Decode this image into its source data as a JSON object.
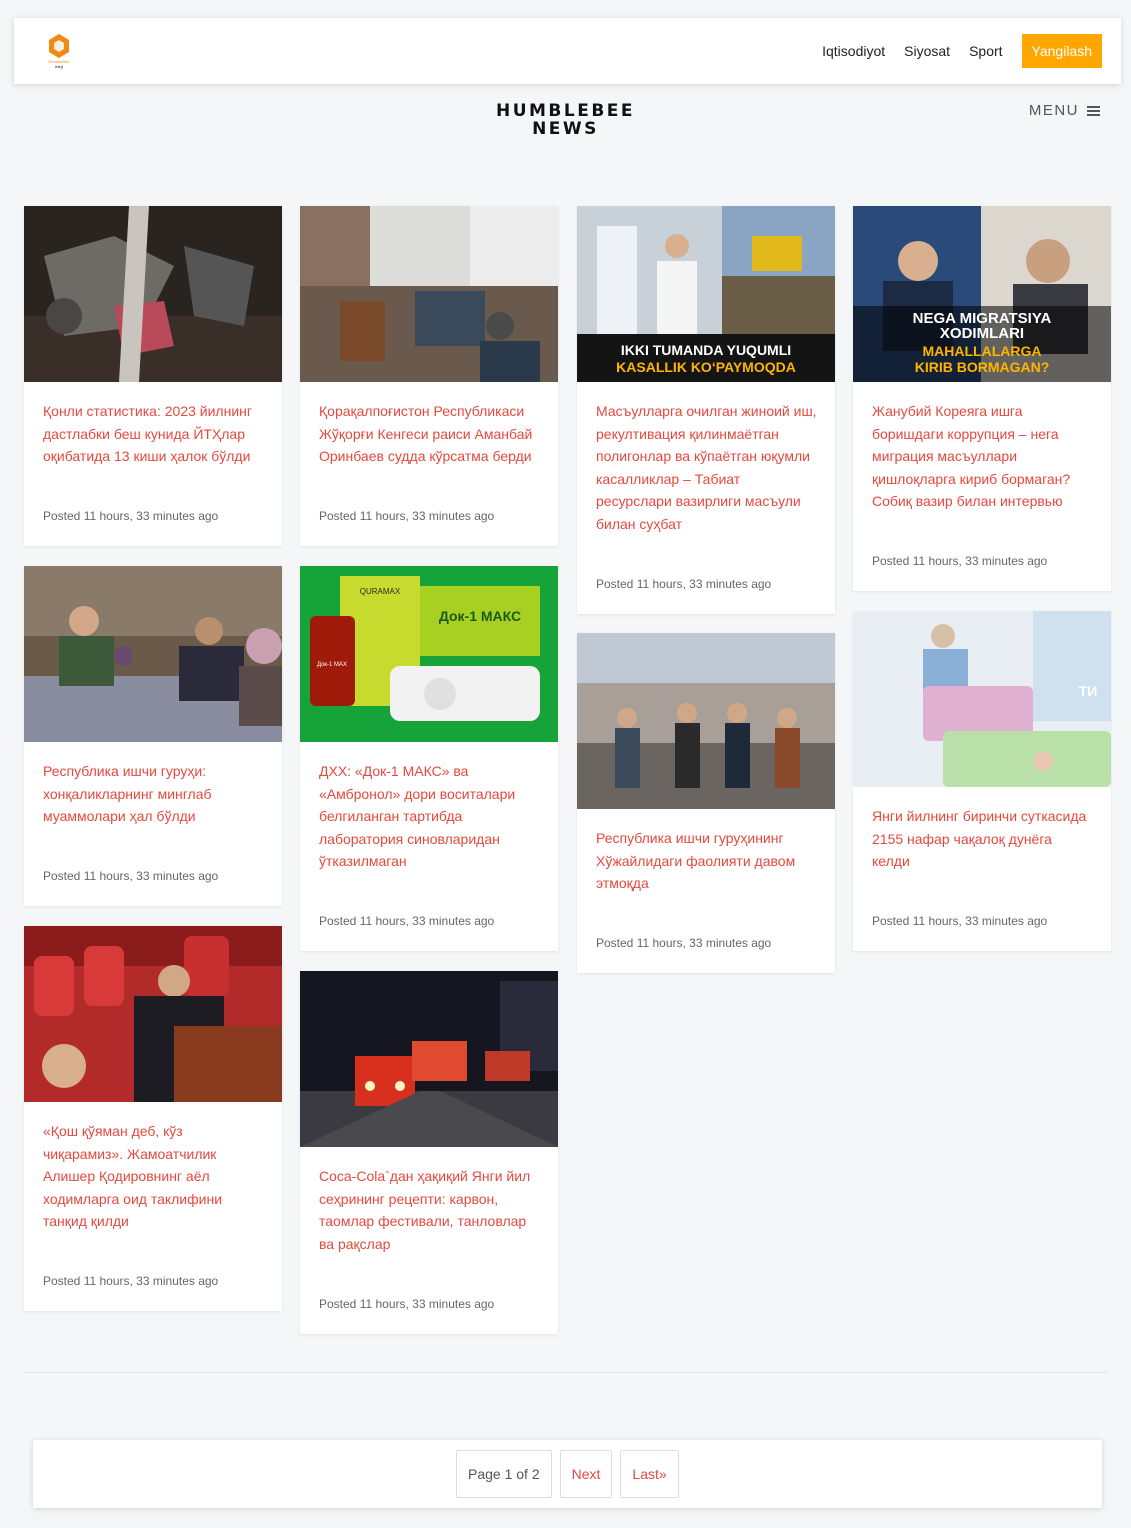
{
  "header": {
    "logo_text": "HumbleBee",
    "logo_sub": "telegi",
    "nav": [
      "Iqtisodiyot",
      "Siyosat",
      "Sport"
    ],
    "cta": "Yangilash"
  },
  "brand": {
    "line1": "HUMBLEBEE",
    "line2": "NEWS"
  },
  "menu_label": "MENU",
  "cards": [
    {
      "title": "Қонли статистика: 2023 йилнинг дастлабки беш кунида ЙТҲлар оқибатида 13 киши ҳалок бўлди",
      "posted": "Posted 11 hours, 33 minutes ago"
    },
    {
      "title": "Қорақалпоғистон Республикаси Жўқорғи Кенгеси раиси Аманбай Оринбаев судда кўрсатма берди",
      "posted": "Posted 11 hours, 33 minutes ago"
    },
    {
      "title": "Масъулларга очилган жиноий иш, рекултивация қилинмаётган полигонлар ва кўпаётган юқумли касалликлар – Табиат ресурслари вазирлиги масъули билан суҳбат",
      "posted": "Posted 11 hours, 33 minutes ago",
      "overlay": [
        "IKKI TUMANDA YUQUMLI",
        "KASALLIK KO‘PAYMOQDA"
      ]
    },
    {
      "title": "Жанубий Кореяга ишга боришдаги коррупция – нега миграция масъуллари қишлоқларга кириб бормаган? Собиқ вазир билан интервью",
      "posted": "Posted 11 hours, 33 minutes ago",
      "overlay": [
        "NEGA MIGRATSIYA",
        "XODIMLARI",
        "MAHALLALARGA",
        "KIRIB BORMAGAN?"
      ]
    },
    {
      "title": "Республика ишчи гуруҳи: хонқаликларнинг минглаб муаммолари ҳал бўлди",
      "posted": "Posted 11 hours, 33 minutes ago"
    },
    {
      "title": "ДХХ: «Док-1 МАКС» ва «Амбронол» дори воситалари белгиланган тартибда лаборатория синовларидан ўтказилмаган",
      "posted": "Posted 11 hours, 33 minutes ago",
      "overlay": [
        "QURAMAX",
        "Док-1 МАКС",
        "Док-1 MAX"
      ]
    },
    {
      "title": "Республика ишчи гуруҳининг Хўжайлидаги фаолияти давом этмоқда",
      "posted": "Posted 11 hours, 33 minutes ago"
    },
    {
      "title": "Янги йилнинг биринчи суткасида 2155 нафар чақалоқ дунёга келди",
      "posted": "Posted 11 hours, 33 minutes ago",
      "overlay": [
        "TИ"
      ]
    },
    {
      "title": "«Қош қўяман деб, кўз чиқарамиз». Жамоатчилик Алишер Қодировнинг аёл ходимларга оид таклифини танқид қилди",
      "posted": "Posted 11 hours, 33 minutes ago"
    },
    {
      "title": "Coca-Cola`дан ҳақиқий Янги йил сеҳрининг рецепти: карвон, таомлар фестивали, танловлар ва рақслар",
      "posted": "Posted 11 hours, 33 minutes ago"
    }
  ],
  "pagination": {
    "info": "Page 1 of 2",
    "next": "Next",
    "last": "Last»"
  }
}
